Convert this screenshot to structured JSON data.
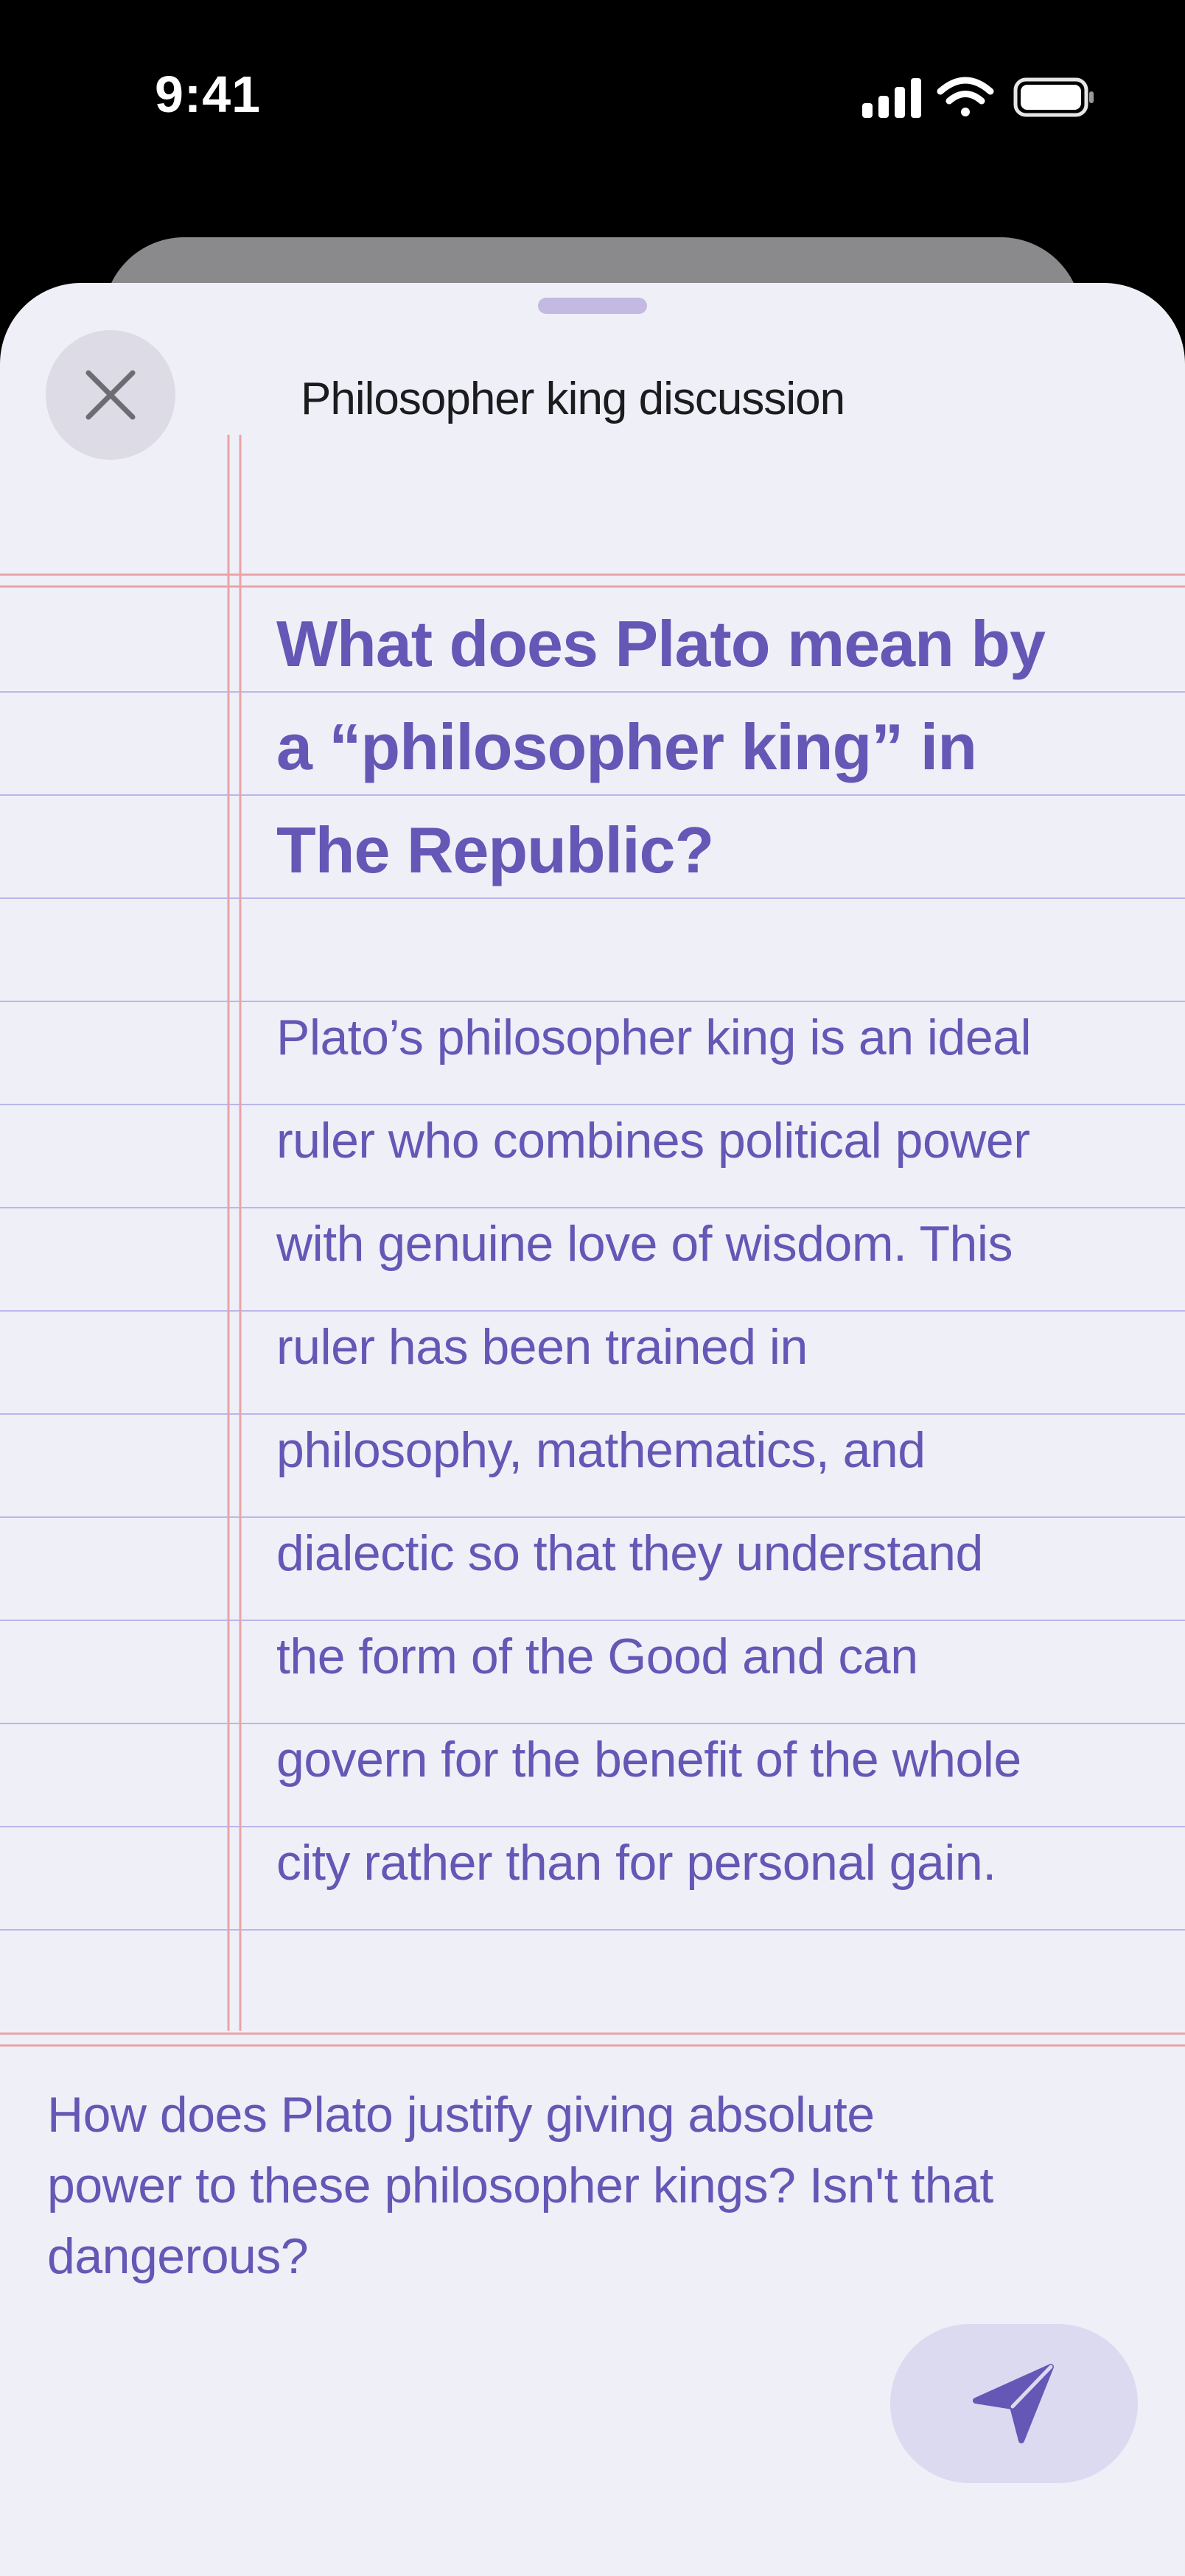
{
  "status_bar": {
    "time": "9:41",
    "icons": [
      "cellular-signal-icon",
      "wifi-icon",
      "battery-icon"
    ]
  },
  "sheet": {
    "title": "Philosopher king discussion",
    "close_icon": "close-icon"
  },
  "question": {
    "lines": [
      "What does Plato mean by",
      "a “philosopher king” in",
      "The Republic?"
    ]
  },
  "answer": {
    "lines": [
      "Plato’s philosopher king is an ideal",
      "ruler who combines political power",
      "with genuine love of wisdom. This",
      "ruler has been trained in",
      "philosophy, mathematics, and",
      "dialectic so that they understand",
      "the form of the Good and can",
      "govern for the benefit of the whole",
      "city rather than for personal gain."
    ]
  },
  "composer": {
    "lines": [
      "How does Plato justify giving absolute",
      "power to these philosopher kings? Isn't that",
      "dangerous?"
    ],
    "send_icon": "send-icon"
  },
  "colors": {
    "accent": "#6457b5",
    "sheet_background": "#efeff8",
    "rule_line": "#b9b7ea",
    "margin_line": "#eba3a6"
  }
}
